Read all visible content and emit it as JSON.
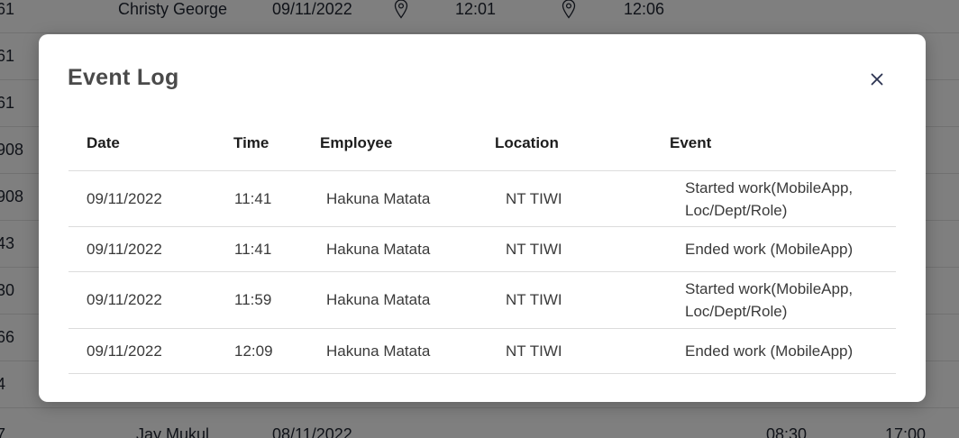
{
  "background": {
    "rows": [
      {
        "id": "61",
        "name": "Christy George",
        "date": "09/11/2022",
        "start": "12:01",
        "end": "12:06",
        "show_pins": true
      },
      {
        "id": "61",
        "name": "",
        "date": "",
        "start": "",
        "end": "",
        "show_pins": false
      },
      {
        "id": "61",
        "name": "",
        "date": "",
        "start": "",
        "end": "",
        "show_pins": false
      },
      {
        "id": "908",
        "name": "",
        "date": "",
        "start": "",
        "end": "",
        "show_pins": false
      },
      {
        "id": "908",
        "name": "",
        "date": "",
        "start": "",
        "end": "",
        "show_pins": false
      },
      {
        "id": "43",
        "name": "",
        "date": "",
        "start": "",
        "end": "",
        "show_pins": false
      },
      {
        "id": "30",
        "name": "",
        "date": "",
        "start": "",
        "end": "",
        "show_pins": false
      },
      {
        "id": "66",
        "name": "",
        "date": "",
        "start": "",
        "end": "",
        "show_pins": false
      },
      {
        "id": "4",
        "name": "",
        "date": "",
        "start": "",
        "end": "",
        "show_pins": false
      },
      {
        "id": "7",
        "name": "Jay Mukul",
        "date": "08/11/2022",
        "start": "08:30",
        "end": "17:00",
        "show_pins": false
      }
    ]
  },
  "modal": {
    "title": "Event Log",
    "close_icon": "close-icon",
    "columns": [
      "Date",
      "Time",
      "Employee",
      "Location",
      "Event"
    ],
    "rows": [
      {
        "date": "09/11/2022",
        "time": "11:41",
        "employee": "Hakuna Matata",
        "location": "NT TIWI",
        "event": "Started work(MobileApp, Loc/Dept/Role)"
      },
      {
        "date": "09/11/2022",
        "time": "11:41",
        "employee": "Hakuna Matata",
        "location": "NT TIWI",
        "event": "Ended work (MobileApp)"
      },
      {
        "date": "09/11/2022",
        "time": "11:59",
        "employee": "Hakuna Matata",
        "location": "NT TIWI",
        "event": "Started work(MobileApp, Loc/Dept/Role)"
      },
      {
        "date": "09/11/2022",
        "time": "12:09",
        "employee": "Hakuna Matata",
        "location": "NT TIWI",
        "event": "Ended work (MobileApp)"
      }
    ]
  },
  "colors": {
    "overlay": "#000000",
    "title": "#4a4a4a",
    "close": "#2b3350"
  }
}
